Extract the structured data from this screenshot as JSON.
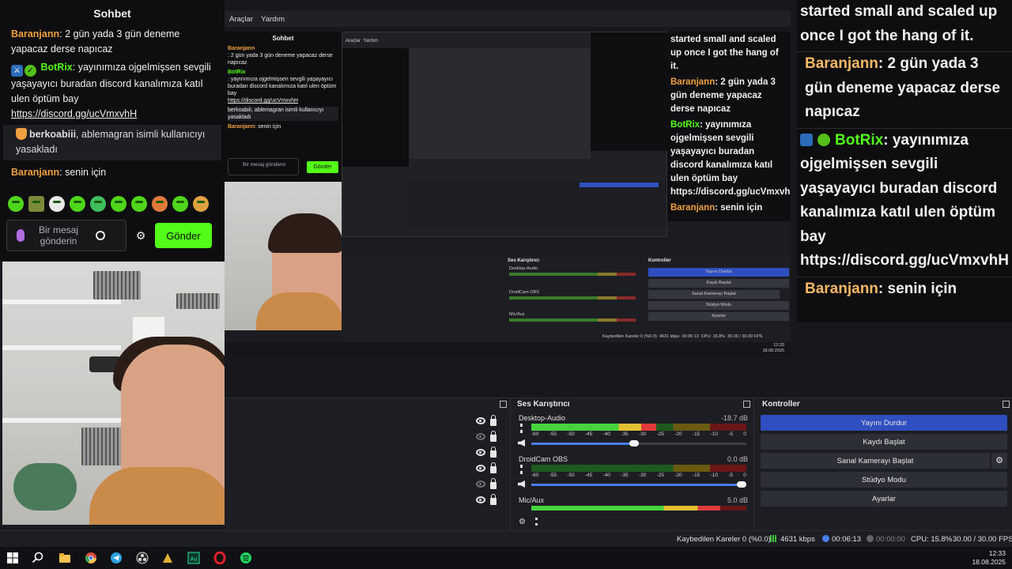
{
  "chat": {
    "title": "Sohbet",
    "messages": [
      {
        "user": "Baranjann",
        "text": ": 2 gün yada 3 gün deneme yapacaz derse napıcaz"
      },
      {
        "user": "BotRix",
        "text": ": yayınımıza ojgelmişsen sevgili yaşayayıcı buradan discord kanalımıza katıl ulen öptüm bay",
        "link": "https://discord.gg/ucVmxvhH"
      },
      {
        "user": "berkoabiii",
        "text": ", ablemagran isimli kullanıcıyı yasakladı"
      },
      {
        "user": "Baranjann",
        "text": ": senin için"
      }
    ],
    "input_placeholder": "Bir mesaj gönderin",
    "send_label": "Gönder"
  },
  "menu": {
    "items": [
      "Araçlar",
      "Yardım"
    ]
  },
  "nested": {
    "chat_title": "Sohbet",
    "menu": [
      "Araçlar",
      "Yardım"
    ],
    "right_text": [
      {
        "text": "started small and scaled up once I got the hang of it."
      },
      {
        "user": "Baranjann",
        "text": ": 2 gün yada 3 gün deneme yapacaz derse napıcaz"
      },
      {
        "user": "BotRix",
        "text": ": yayınımıza ojgelmişsen sevgili yaşayayıcı buradan discord kanalımıza katıl ulen öptüm bay https://discord.gg/ucVmxvhH"
      },
      {
        "user": "Baranjann",
        "text": ": senin için"
      }
    ]
  },
  "overlay_chat": {
    "intro": "started small and scaled up once I got the hang of it.",
    "messages": [
      {
        "user": "Baranjann",
        "text": ": 2 gün yada 3 gün deneme yapacaz derse napıcaz"
      },
      {
        "user": "BotRix",
        "text": ": yayınımıza ojgelmişsen sevgili yaşayayıcı buradan discord kanalımıza katıl ulen öptüm bay",
        "link": "https://discord.gg/ucVmxvhH"
      },
      {
        "user": "Baranjann",
        "text": ": senin için"
      }
    ]
  },
  "mixer": {
    "title": "Ses Karıştırıcı",
    "ticks": [
      "-60",
      "-55",
      "-50",
      "-45",
      "-40",
      "-35",
      "-30",
      "-25",
      "-20",
      "-15",
      "-10",
      "-5",
      "0"
    ],
    "channels": [
      {
        "name": "Desktop-Audio",
        "db": "-18.7 dB",
        "level": 0.58,
        "volume": 0.5
      },
      {
        "name": "DroidCam OBS",
        "db": "0.0 dB",
        "level": 0.0,
        "volume": 1.0
      },
      {
        "name": "Mic/Aux",
        "db": "5.0 dB",
        "level": 0.88,
        "volume": 1.0
      }
    ]
  },
  "controls": {
    "title": "Kontroller",
    "stop_stream": "Yayını Durdur",
    "start_record": "Kaydı Başlat",
    "virtual_cam": "Sanal Kamerayı Başlat",
    "studio_mode": "Stüdyo Modu",
    "settings": "Ayarlar"
  },
  "status": {
    "dropped": "Kaybedilen Kareler 0 (%0.0)",
    "bitrate": "4631 kbps",
    "stream_time": "00:06:13",
    "record_time": "00:00:00",
    "cpu": "CPU: 15.8%",
    "fps": "30.00 / 30.00 FPS"
  },
  "taskbar": {
    "time": "12:33",
    "date": "18.08.2025"
  },
  "colors": {
    "kick_green": "#53fc18",
    "obs_blue": "#2f4ec0",
    "user_orange": "#f0a040"
  }
}
